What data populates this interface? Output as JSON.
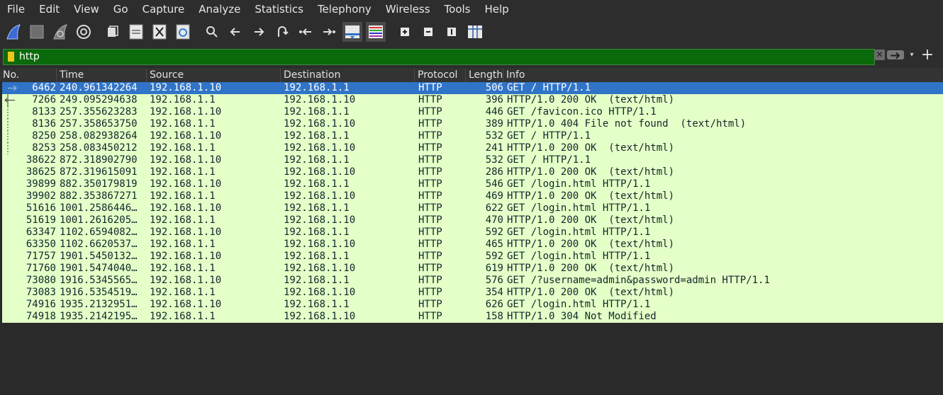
{
  "menu": [
    "File",
    "Edit",
    "View",
    "Go",
    "Capture",
    "Analyze",
    "Statistics",
    "Telephony",
    "Wireless",
    "Tools",
    "Help"
  ],
  "toolbar": {
    "icons": [
      "shark-fin-start-icon",
      "stop-capture-icon",
      "restart-capture-icon",
      "capture-options-icon",
      "open-file-icon",
      "save-file-icon",
      "close-file-icon",
      "reload-file-icon",
      "find-packet-icon",
      "go-back-icon",
      "go-forward-icon",
      "go-to-packet-icon",
      "go-first-packet-icon",
      "go-last-packet-icon",
      "auto-scroll-icon",
      "colorize-icon",
      "zoom-in-icon",
      "zoom-out-icon",
      "normal-size-icon",
      "resize-columns-icon"
    ]
  },
  "filter": {
    "value": "http",
    "clear_symbol": "✕",
    "add_symbol": "+",
    "dropdown_symbol": "▾"
  },
  "columns": {
    "no": "No.",
    "time": "Time",
    "source": "Source",
    "destination": "Destination",
    "protocol": "Protocol",
    "length": "Length",
    "info": "Info"
  },
  "colors": {
    "row_bg": "#e4ffc7",
    "selected_bg": "#3074c8",
    "filter_bg": "#0b6a0b"
  },
  "packets": [
    {
      "no": "6462",
      "time": "240.961342264",
      "src": "192.168.1.10",
      "dst": "192.168.1.1",
      "proto": "HTTP",
      "len": "506",
      "info": "GET / HTTP/1.1",
      "selected": true
    },
    {
      "no": "7266",
      "time": "249.095294638",
      "src": "192.168.1.1",
      "dst": "192.168.1.10",
      "proto": "HTTP",
      "len": "396",
      "info": "HTTP/1.0 200 OK  (text/html)"
    },
    {
      "no": "8133",
      "time": "257.355623283",
      "src": "192.168.1.10",
      "dst": "192.168.1.1",
      "proto": "HTTP",
      "len": "446",
      "info": "GET /favicon.ico HTTP/1.1"
    },
    {
      "no": "8136",
      "time": "257.358653750",
      "src": "192.168.1.1",
      "dst": "192.168.1.10",
      "proto": "HTTP",
      "len": "389",
      "info": "HTTP/1.0 404 File not found  (text/html)"
    },
    {
      "no": "8250",
      "time": "258.082938264",
      "src": "192.168.1.10",
      "dst": "192.168.1.1",
      "proto": "HTTP",
      "len": "532",
      "info": "GET / HTTP/1.1"
    },
    {
      "no": "8253",
      "time": "258.083450212",
      "src": "192.168.1.1",
      "dst": "192.168.1.10",
      "proto": "HTTP",
      "len": "241",
      "info": "HTTP/1.0 200 OK  (text/html)"
    },
    {
      "no": "38622",
      "time": "872.318902790",
      "src": "192.168.1.10",
      "dst": "192.168.1.1",
      "proto": "HTTP",
      "len": "532",
      "info": "GET / HTTP/1.1"
    },
    {
      "no": "38625",
      "time": "872.319615091",
      "src": "192.168.1.1",
      "dst": "192.168.1.10",
      "proto": "HTTP",
      "len": "286",
      "info": "HTTP/1.0 200 OK  (text/html)"
    },
    {
      "no": "39899",
      "time": "882.350179819",
      "src": "192.168.1.10",
      "dst": "192.168.1.1",
      "proto": "HTTP",
      "len": "546",
      "info": "GET /login.html HTTP/1.1"
    },
    {
      "no": "39902",
      "time": "882.353867271",
      "src": "192.168.1.1",
      "dst": "192.168.1.10",
      "proto": "HTTP",
      "len": "469",
      "info": "HTTP/1.0 200 OK  (text/html)"
    },
    {
      "no": "51616",
      "time": "1001.2586446…",
      "src": "192.168.1.10",
      "dst": "192.168.1.1",
      "proto": "HTTP",
      "len": "622",
      "info": "GET /login.html HTTP/1.1"
    },
    {
      "no": "51619",
      "time": "1001.2616205…",
      "src": "192.168.1.1",
      "dst": "192.168.1.10",
      "proto": "HTTP",
      "len": "470",
      "info": "HTTP/1.0 200 OK  (text/html)"
    },
    {
      "no": "63347",
      "time": "1102.6594082…",
      "src": "192.168.1.10",
      "dst": "192.168.1.1",
      "proto": "HTTP",
      "len": "592",
      "info": "GET /login.html HTTP/1.1"
    },
    {
      "no": "63350",
      "time": "1102.6620537…",
      "src": "192.168.1.1",
      "dst": "192.168.1.10",
      "proto": "HTTP",
      "len": "465",
      "info": "HTTP/1.0 200 OK  (text/html)"
    },
    {
      "no": "71757",
      "time": "1901.5450132…",
      "src": "192.168.1.10",
      "dst": "192.168.1.1",
      "proto": "HTTP",
      "len": "592",
      "info": "GET /login.html HTTP/1.1"
    },
    {
      "no": "71760",
      "time": "1901.5474040…",
      "src": "192.168.1.1",
      "dst": "192.168.1.10",
      "proto": "HTTP",
      "len": "619",
      "info": "HTTP/1.0 200 OK  (text/html)"
    },
    {
      "no": "73080",
      "time": "1916.5345565…",
      "src": "192.168.1.10",
      "dst": "192.168.1.1",
      "proto": "HTTP",
      "len": "576",
      "info": "GET /?username=admin&password=admin HTTP/1.1"
    },
    {
      "no": "73083",
      "time": "1916.5354519…",
      "src": "192.168.1.1",
      "dst": "192.168.1.10",
      "proto": "HTTP",
      "len": "354",
      "info": "HTTP/1.0 200 OK  (text/html)"
    },
    {
      "no": "74916",
      "time": "1935.2132951…",
      "src": "192.168.1.10",
      "dst": "192.168.1.1",
      "proto": "HTTP",
      "len": "626",
      "info": "GET /login.html HTTP/1.1"
    },
    {
      "no": "74918",
      "time": "1935.2142195…",
      "src": "192.168.1.1",
      "dst": "192.168.1.10",
      "proto": "HTTP",
      "len": "158",
      "info": "HTTP/1.0 304 Not Modified"
    }
  ]
}
